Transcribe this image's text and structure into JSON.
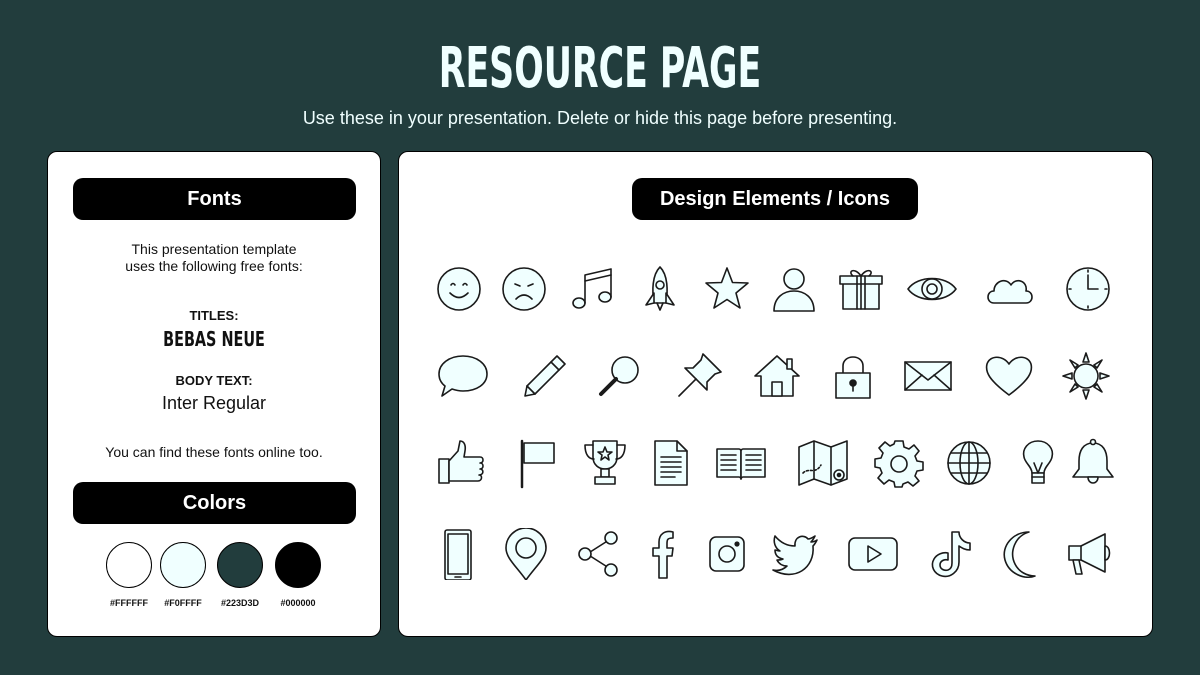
{
  "header": {
    "title": "RESOURCE PAGE",
    "subtitle": "Use these in your presentation. Delete or hide this page before presenting."
  },
  "fonts_panel": {
    "heading": "Fonts",
    "intro_line1": "This presentation template",
    "intro_line2": "uses the following free fonts:",
    "titles_label": "TITLES:",
    "titles_font": "BEBAS NEUE",
    "body_label": "BODY TEXT:",
    "body_font": "Inter Regular",
    "note": "You can find these fonts online too."
  },
  "colors_panel": {
    "heading": "Colors",
    "swatches": [
      {
        "hex": "#FFFFFF",
        "label": "#FFFFFF"
      },
      {
        "hex": "#F0FFFF",
        "label": "#F0FFFF"
      },
      {
        "hex": "#223D3D",
        "label": "#223D3D"
      },
      {
        "hex": "#000000",
        "label": "#000000"
      }
    ]
  },
  "icons_panel": {
    "heading": "Design Elements / Icons",
    "icons": [
      "smile-icon",
      "sad-icon",
      "music-note-icon",
      "rocket-icon",
      "star-icon",
      "user-icon",
      "gift-icon",
      "eye-icon",
      "cloud-icon",
      "clock-icon",
      "speech-bubble-icon",
      "pencil-icon",
      "magnifier-icon",
      "pushpin-icon",
      "house-icon",
      "padlock-icon",
      "envelope-icon",
      "heart-icon",
      "sun-icon",
      "thumbs-up-icon",
      "flag-icon",
      "trophy-icon",
      "document-icon",
      "open-book-icon",
      "map-icon",
      "gear-icon",
      "globe-icon",
      "lightbulb-icon",
      "bell-icon",
      "phone-icon",
      "location-pin-icon",
      "share-icon",
      "facebook-icon",
      "instagram-icon",
      "twitter-icon",
      "youtube-icon",
      "tiktok-icon",
      "moon-icon",
      "megaphone-icon"
    ]
  },
  "colors": {
    "background": "#223D3D",
    "panel": "#FFFFFF",
    "accent_fill": "#F0FFFF",
    "pill": "#000000"
  }
}
